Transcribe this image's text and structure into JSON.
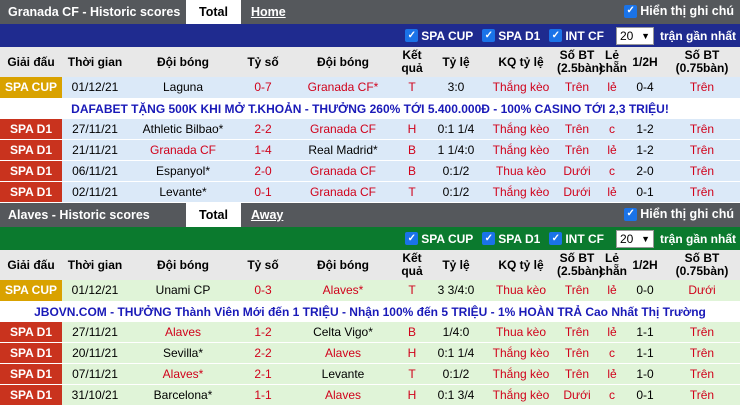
{
  "section1": {
    "title": "Granada CF - Historic scores",
    "tab_active": "Total",
    "tab_other": "Home",
    "show_all": "Hiển thị ghi chú",
    "filters": [
      "SPA CUP",
      "SPA D1",
      "INT CF"
    ],
    "select_value": "20",
    "recent_label": "trận gần nhất",
    "headers": [
      "Giải đấu",
      "Thời gian",
      "Đội bóng",
      "Tỷ số",
      "Đội bóng",
      "Kết quả",
      "Tỷ lệ",
      "KQ tỷ lệ",
      "Số BT (2.5bàn)",
      "Lẻ chẵn",
      "1/2H",
      "Số BT (0.75bàn)"
    ],
    "rows_before_ad": [
      {
        "league": "SPA CUP",
        "date": "01/12/21",
        "home": "Laguna",
        "score": "0-7",
        "away": "Granada CF*",
        "result": "T",
        "odds": "3:0",
        "odds_result": "Thắng kèo",
        "ou": "Trên",
        "oe": "lẻ",
        "half": "0-4",
        "ou2": "Trên"
      }
    ],
    "ad": "DAFABET TẶNG 500K KHI MỞ T.KHOẢN - THƯỞNG 260% TỚI 5.400.000Đ - 100% CASINO TỚI 2,3 TRIỆU!",
    "rows_after_ad": [
      {
        "league": "SPA D1",
        "date": "27/11/21",
        "home": "Athletic Bilbao*",
        "score": "2-2",
        "away": "Granada CF",
        "result": "H",
        "odds": "0:1 1/4",
        "odds_result": "Thắng kèo",
        "ou": "Trên",
        "oe": "c",
        "half": "1-2",
        "ou2": "Trên"
      },
      {
        "league": "SPA D1",
        "date": "21/11/21",
        "home": "Granada CF",
        "score": "1-4",
        "away": "Real Madrid*",
        "result": "B",
        "odds": "1 1/4:0",
        "odds_result": "Thắng kèo",
        "ou": "Trên",
        "oe": "lẻ",
        "half": "1-2",
        "ou2": "Trên"
      },
      {
        "league": "SPA D1",
        "date": "06/11/21",
        "home": "Espanyol*",
        "score": "2-0",
        "away": "Granada CF",
        "result": "B",
        "odds": "0:1/2",
        "odds_result": "Thua kèo",
        "ou": "Dưới",
        "oe": "c",
        "half": "2-0",
        "ou2": "Trên"
      },
      {
        "league": "SPA D1",
        "date": "02/11/21",
        "home": "Levante*",
        "score": "0-1",
        "away": "Granada CF",
        "result": "T",
        "odds": "0:1/2",
        "odds_result": "Thắng kèo",
        "ou": "Dưới",
        "oe": "lẻ",
        "half": "0-1",
        "ou2": "Trên"
      }
    ]
  },
  "section2": {
    "title": "Alaves - Historic scores",
    "tab_active": "Total",
    "tab_other": "Away",
    "show_all": "Hiển thị ghi chú",
    "filters": [
      "SPA CUP",
      "SPA D1",
      "INT CF"
    ],
    "select_value": "20",
    "recent_label": "trận gần nhất",
    "headers": [
      "Giải đấu",
      "Thời gian",
      "Đội bóng",
      "Tỷ số",
      "Đội bóng",
      "Kết quả",
      "Tỷ lệ",
      "KQ tỷ lệ",
      "Số BT (2.5bàn)",
      "Lẻ chẵn",
      "1/2H",
      "Số BT (0.75bàn)"
    ],
    "rows_before_ad": [
      {
        "league": "SPA CUP",
        "date": "01/12/21",
        "home": "Unami CP",
        "score": "0-3",
        "away": "Alaves*",
        "result": "T",
        "odds": "3 3/4:0",
        "odds_result": "Thua kèo",
        "ou": "Trên",
        "oe": "lẻ",
        "half": "0-0",
        "ou2": "Dưới"
      }
    ],
    "ad": "JBOVN.COM - THƯỞNG Thành Viên Mới đến 1 TRIỆU - Nhận 100% đến 5 TRIỆU - 1% HOÀN TRẢ Cao Nhất Thị Trường",
    "rows_after_ad": [
      {
        "league": "SPA D1",
        "date": "27/11/21",
        "home": "Alaves",
        "score": "1-2",
        "away": "Celta Vigo*",
        "result": "B",
        "odds": "1/4:0",
        "odds_result": "Thua kèo",
        "ou": "Trên",
        "oe": "lẻ",
        "half": "1-1",
        "ou2": "Trên"
      },
      {
        "league": "SPA D1",
        "date": "20/11/21",
        "home": "Sevilla*",
        "score": "2-2",
        "away": "Alaves",
        "result": "H",
        "odds": "0:1 1/4",
        "odds_result": "Thắng kèo",
        "ou": "Trên",
        "oe": "c",
        "half": "1-1",
        "ou2": "Trên"
      },
      {
        "league": "SPA D1",
        "date": "07/11/21",
        "home": "Alaves*",
        "score": "2-1",
        "away": "Levante",
        "result": "T",
        "odds": "0:1/2",
        "odds_result": "Thắng kèo",
        "ou": "Trên",
        "oe": "lẻ",
        "half": "1-0",
        "ou2": "Trên"
      },
      {
        "league": "SPA D1",
        "date": "31/10/21",
        "home": "Barcelona*",
        "score": "1-1",
        "away": "Alaves",
        "result": "H",
        "odds": "0:1 3/4",
        "odds_result": "Thắng kèo",
        "ou": "Dưới",
        "oe": "c",
        "half": "0-1",
        "ou2": "Trên"
      }
    ]
  },
  "colors": {
    "header_gray": "#55585c",
    "filter_blue": "#1f2b8f",
    "filter_green": "#0b7a2e",
    "cup_badge": "#d9a200",
    "d1_badge": "#c9331e",
    "row_blue": "#dbe9f8",
    "row_green": "#e0f4d8",
    "highlight_red": "#d0021b"
  }
}
